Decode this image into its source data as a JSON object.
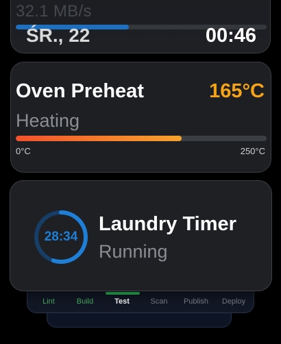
{
  "top_card": {
    "network_speed": "32.1 MB/s",
    "network_progress": 0.45,
    "date": "ŚR., 22",
    "time": "00:46"
  },
  "oven": {
    "title": "Oven Preheat",
    "temperature": "165°C",
    "status": "Heating",
    "progress": 0.66,
    "range_min": "0°C",
    "range_max": "250°C",
    "accent": "#f5a319"
  },
  "laundry": {
    "title": "Laundry Timer",
    "status": "Running",
    "timer": "28:34",
    "progress": 0.55,
    "accent": "#1f7ed6"
  },
  "pipeline": {
    "steps": [
      {
        "label": "Lint",
        "state": "done"
      },
      {
        "label": "Build",
        "state": "done"
      },
      {
        "label": "Test",
        "state": "active"
      },
      {
        "label": "Scan",
        "state": "pending"
      },
      {
        "label": "Publish",
        "state": "pending"
      },
      {
        "label": "Deploy",
        "state": "pending"
      }
    ]
  }
}
